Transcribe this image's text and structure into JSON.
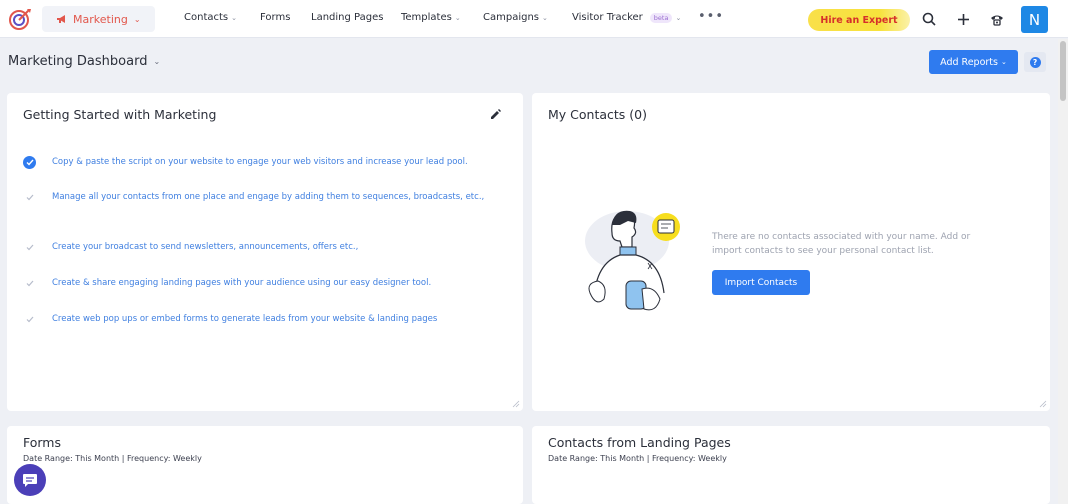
{
  "nav": {
    "module_label": "Marketing",
    "items": [
      {
        "label": "Contacts",
        "dropdown": true
      },
      {
        "label": "Forms",
        "dropdown": false
      },
      {
        "label": "Landing Pages",
        "dropdown": false
      },
      {
        "label": "Templates",
        "dropdown": true
      },
      {
        "label": "Campaigns",
        "dropdown": true
      },
      {
        "label": "Visitor Tracker",
        "dropdown": true,
        "badge": "beta"
      }
    ],
    "more_label": "•••",
    "hire_label": "Hire an Expert",
    "avatar_initial": "N",
    "icons": [
      "search-icon",
      "plus-icon",
      "phone-icon"
    ]
  },
  "page": {
    "title": "Marketing Dashboard",
    "add_reports_label": "Add Reports",
    "help_label": "?"
  },
  "getting_started": {
    "title": "Getting Started with Marketing",
    "items": [
      {
        "text": "Copy & paste the script on your website to engage your web visitors and increase your lead pool.",
        "done": true
      },
      {
        "text": "Manage all your contacts from one place and engage by adding them to sequences, broadcasts, etc.,",
        "done": false
      },
      {
        "text": "Create your broadcast to send newsletters, announcements, offers etc.,",
        "done": false
      },
      {
        "text": "Create & share engaging landing pages with your audience using our easy designer tool.",
        "done": false
      },
      {
        "text": "Create web pop ups or embed forms to generate leads from your website & landing pages",
        "done": false
      }
    ]
  },
  "my_contacts": {
    "title": "My Contacts (0)",
    "empty_message": "There are no contacts associated with your name. Add or import contacts to see your personal contact list.",
    "import_label": "Import Contacts"
  },
  "forms_card": {
    "title": "Forms",
    "subtitle": "Date Range: This Month | Frequency: Weekly"
  },
  "landing_card": {
    "title": "Contacts from Landing Pages",
    "subtitle": "Date Range: This Month | Frequency: Weekly"
  },
  "colors": {
    "accent": "#2f7bef",
    "module": "#e2574c",
    "hire_bg": "#f9e04a",
    "hire_text": "#d6302a",
    "chat": "#4b3fb8"
  }
}
